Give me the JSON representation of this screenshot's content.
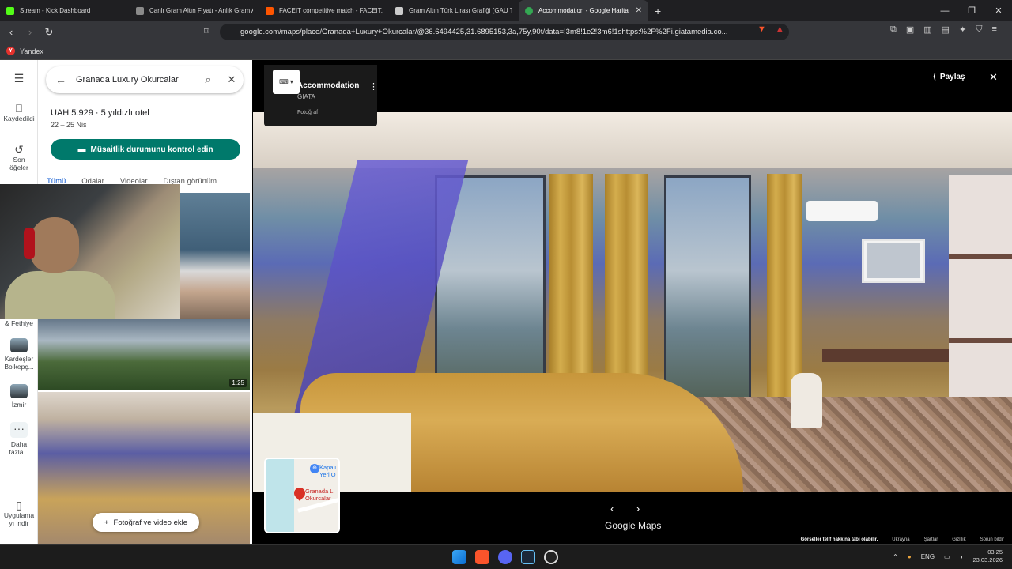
{
  "browser": {
    "tabs": [
      {
        "title": "Stream - Kick Dashboard",
        "color": "#53fc18",
        "active": false
      },
      {
        "title": "Canlı Gram Altın Fiyatı - Anlık Gram A",
        "color": "#8a8a8a",
        "active": false
      },
      {
        "title": "FACEIT competitive match - FACEIT.c",
        "color": "#ff5500",
        "active": false
      },
      {
        "title": "Gram Altın Türk Lirası Grafiği (GAU Ti",
        "color": "#cccccc",
        "active": false
      },
      {
        "title": "Accommodation - Google Harita",
        "color": "#34a853",
        "active": true
      }
    ],
    "new_tab": "+",
    "url": "google.com/maps/place/Granada+Luxury+Okurcalar/@36.6494425,31.6895153,3a,75y,90t/data=!3m8!1e2!3m6!1shttps:%2F%2Fi.giatamedia.co...",
    "bookmark": "Yandex"
  },
  "rail": {
    "saved": "Kaydedildi",
    "recent_line1": "Son",
    "recent_line2": "öğeler",
    "fethiye": "& Fethiye",
    "kardesler_line1": "Kardeşler",
    "kardesler_line2": "Bolkepç...",
    "izmir": "İzmir",
    "more_line1": "Daha",
    "more_line2": "fazla...",
    "app_line1": "Uygulama",
    "app_line2": "yı indir"
  },
  "panel": {
    "search_value": "Granada Luxury Okurcalar",
    "price": "UAH 5.929 · 5 yıldızlı otel",
    "dates": "22 – 25 Nis",
    "availability_button": "Müsaitlik durumunu kontrol edin",
    "tabs": [
      "Tümü",
      "Odalar",
      "Videolar",
      "Dıştan görünüm"
    ],
    "video_duration": "1:25",
    "add_media_button": "Fotoğraf ve video ekle"
  },
  "viewer": {
    "title": "Accommodation",
    "source": "GIATA",
    "category": "Fotoğraf",
    "share": "Paylaş",
    "minimap_place_line1": "Granada L",
    "minimap_place_line2": "Okurcalar",
    "minimap_poi_line1": "Kapalı",
    "minimap_poi_line2": "Yeri O",
    "logo": "Google Maps",
    "footer_copyright": "Görseller telif hakkına tabi olabilir.",
    "footer_links": [
      "Ukrayna",
      "Şartlar",
      "Gizlilik",
      "Sorun bildir"
    ]
  },
  "taskbar": {
    "lang": "ENG",
    "time": "03:25",
    "date": "23.03.2026"
  }
}
